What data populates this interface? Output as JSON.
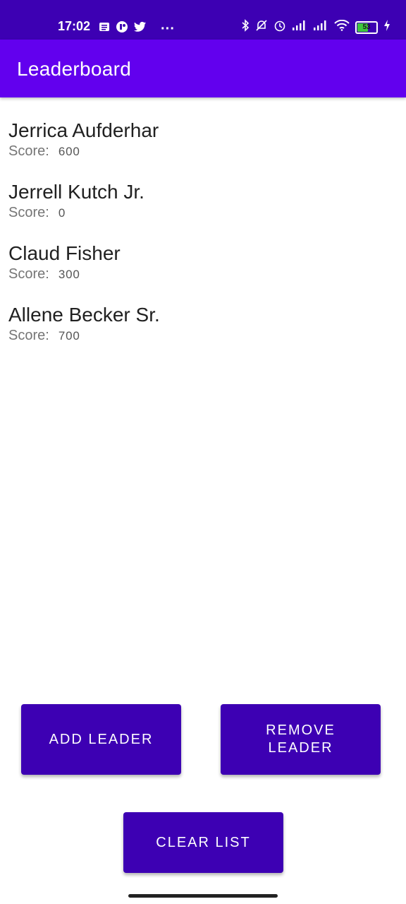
{
  "status_bar": {
    "time": "17:02",
    "left_icons": [
      "message-icon",
      "app-icon",
      "twitter-icon",
      "more-icon"
    ],
    "more_glyph": "···",
    "right_icons": [
      "bluetooth-icon",
      "muted-bell-icon",
      "alarm-icon",
      "signal-icon",
      "signal-icon",
      "wifi-icon",
      "battery-icon",
      "charging-icon"
    ],
    "battery_level": "53",
    "background_color": "#3d00b3"
  },
  "app_bar": {
    "title": "Leaderboard",
    "background_color": "#6200ee"
  },
  "leaders": [
    {
      "name": "Jerrica Aufderhar",
      "score_label": "Score:",
      "score": "600"
    },
    {
      "name": "Jerrell Kutch Jr.",
      "score_label": "Score:",
      "score": "0"
    },
    {
      "name": "Claud Fisher",
      "score_label": "Score:",
      "score": "300"
    },
    {
      "name": "Allene Becker Sr.",
      "score_label": "Score:",
      "score": "700"
    }
  ],
  "buttons": {
    "add_label": "ADD LEADER",
    "remove_label_line1": "REMOVE",
    "remove_label_line2": "LEADER",
    "clear_label": "CLEAR LIST",
    "color": "#3d00b3"
  }
}
